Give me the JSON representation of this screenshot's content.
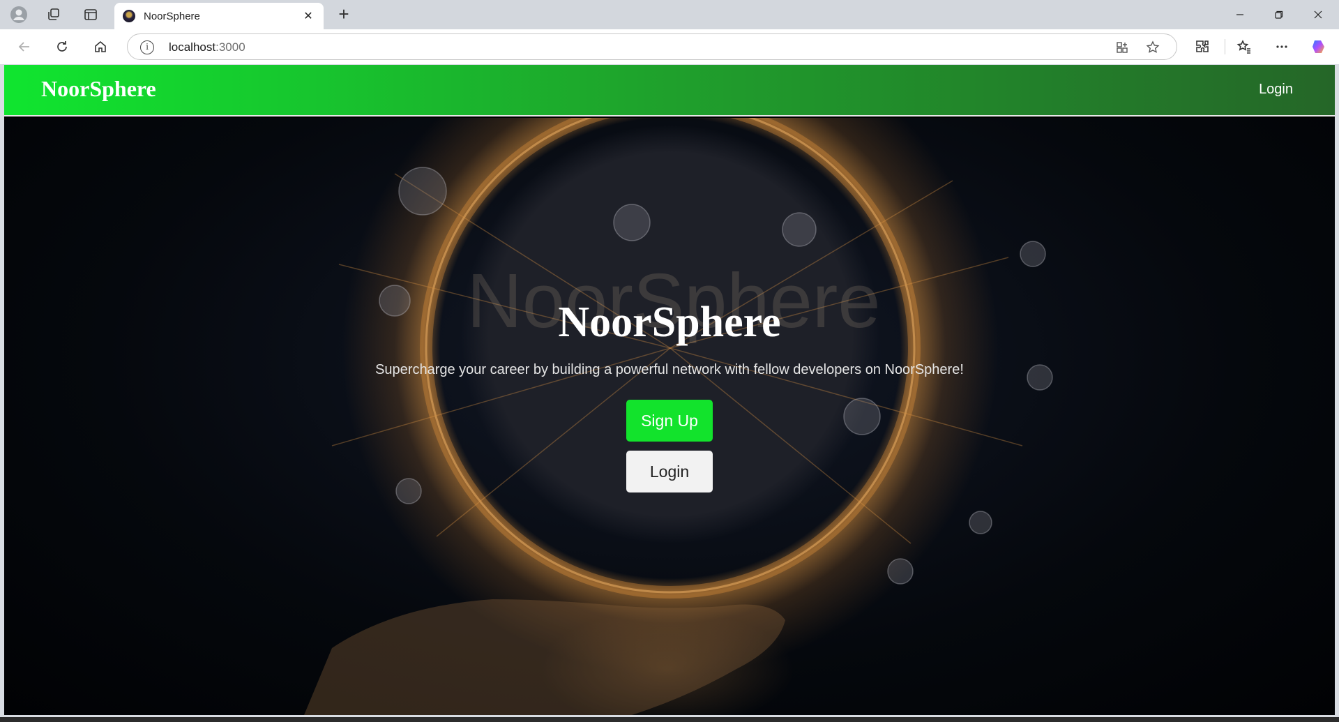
{
  "browser": {
    "tab_title": "NoorSphere",
    "address_host": "localhost",
    "address_port": ":3000",
    "icons": [
      "profile-icon",
      "workspaces-icon",
      "tab-actions-icon",
      "favicon",
      "close-icon",
      "new-tab-icon",
      "minimize-icon",
      "restore-icon",
      "window-close-icon",
      "back-icon",
      "refresh-icon",
      "home-icon",
      "site-info-icon",
      "app-available-icon",
      "favorite-star-icon",
      "extensions-icon",
      "favorites-icon",
      "more-icon",
      "copilot-icon"
    ]
  },
  "navbar": {
    "brand": "NoorSphere",
    "login_label": "Login"
  },
  "hero": {
    "title": "NoorSphere",
    "subtitle": "Supercharge your career by building a powerful network with fellow developers on NoorSphere!",
    "signup_label": "Sign Up",
    "login_label": "Login"
  },
  "colors": {
    "navbar_gradient_start": "#10e52f",
    "navbar_gradient_end": "#256628",
    "signup_button": "#12e32c",
    "login_button": "#f2f2f2"
  }
}
